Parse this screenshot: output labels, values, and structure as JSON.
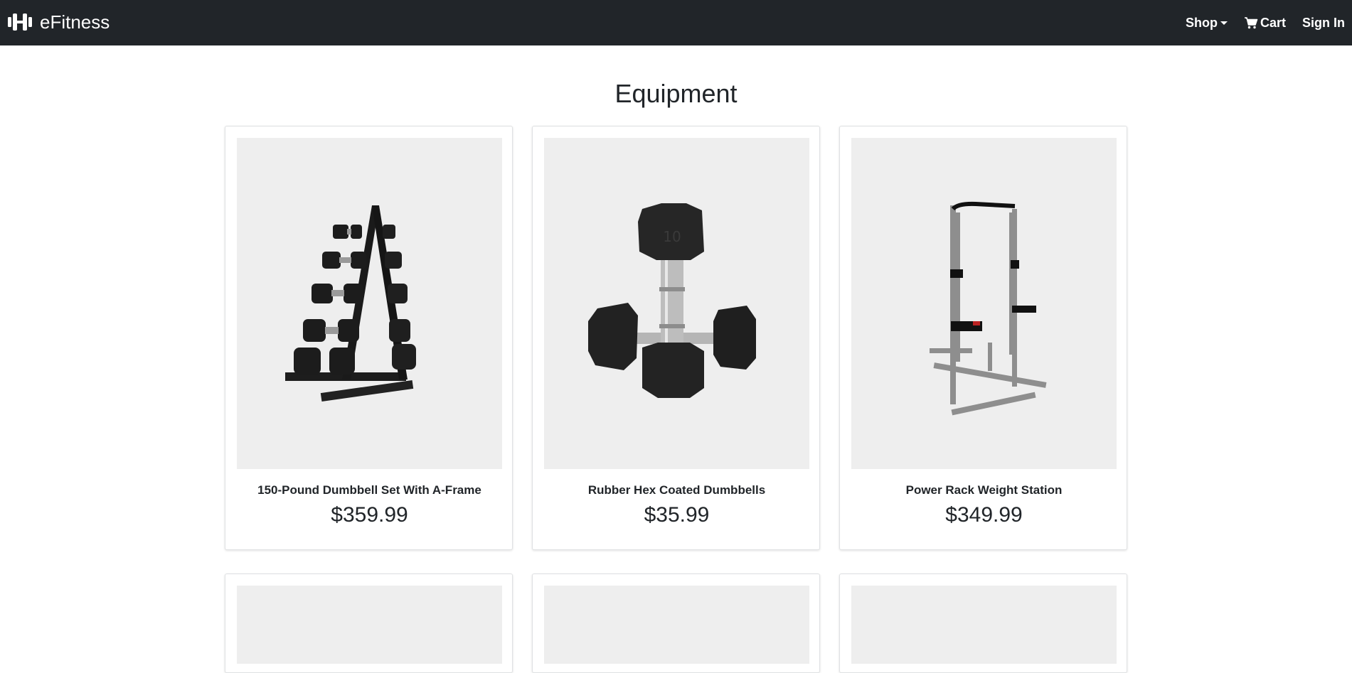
{
  "navbar": {
    "brand": "eFitness",
    "brand_icon": "dumbbell-logo-icon",
    "shop_label": "Shop",
    "cart_label": "Cart",
    "cart_icon": "shopping-cart-icon",
    "signin_label": "Sign In",
    "background": "#212529"
  },
  "page": {
    "title": "Equipment"
  },
  "products": [
    {
      "name": "150-Pound Dumbbell Set With A-Frame",
      "price": "$359.99",
      "image": "dumbbell-rack-image"
    },
    {
      "name": "Rubber Hex Coated Dumbbells",
      "price": "$35.99",
      "image": "hex-dumbbells-image"
    },
    {
      "name": "Power Rack Weight Station",
      "price": "$349.99",
      "image": "power-rack-image"
    }
  ]
}
